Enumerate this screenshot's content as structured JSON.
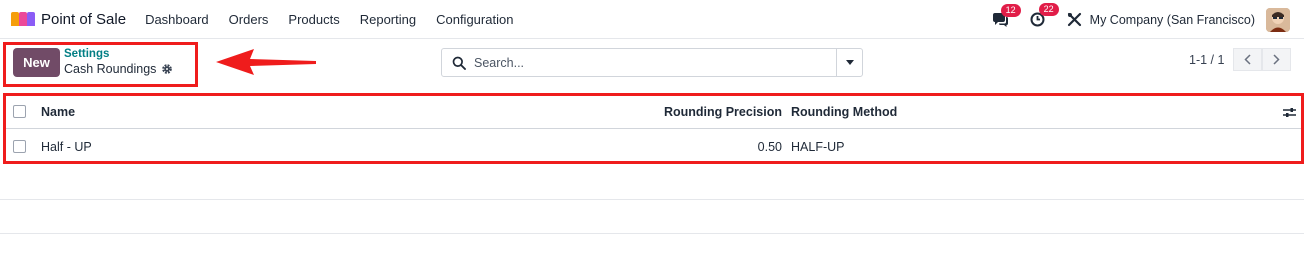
{
  "app": {
    "name": "Point of Sale",
    "icon": "pos-app-icon"
  },
  "menu": [
    {
      "label": "Dashboard"
    },
    {
      "label": "Orders"
    },
    {
      "label": "Products"
    },
    {
      "label": "Reporting"
    },
    {
      "label": "Configuration"
    }
  ],
  "systray": {
    "messages_count": "12",
    "activities_count": "22",
    "company": "My Company (San Francisco)"
  },
  "control_panel": {
    "new_label": "New",
    "breadcrumb_parent": "Settings",
    "breadcrumb_current": "Cash Roundings",
    "search_placeholder": "Search...",
    "pager": "1-1 / 1"
  },
  "table": {
    "columns": [
      "Name",
      "Rounding Precision",
      "Rounding Method"
    ],
    "rows": [
      {
        "name": "Half - UP",
        "precision": "0.50",
        "method": "HALF-UP"
      }
    ]
  },
  "colors": {
    "brand": "#714B67",
    "accent": "#017e84",
    "highlight": "#ef1c1c",
    "badge": "#e11d48"
  }
}
